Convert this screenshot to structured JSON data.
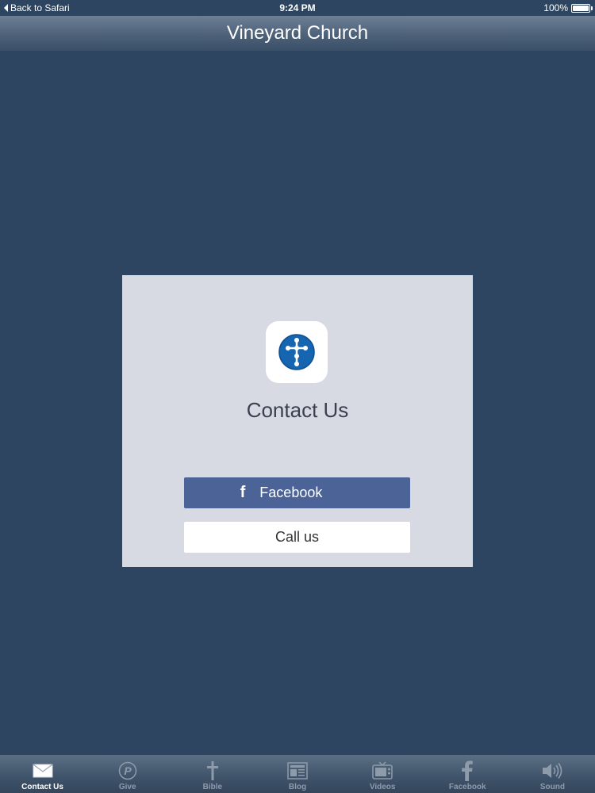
{
  "status_bar": {
    "back_label": "Back to Safari",
    "time": "9:24 PM",
    "battery": "100%",
    "battery_level": 1.0
  },
  "nav": {
    "title": "Vineyard Church"
  },
  "card": {
    "title": "Contact Us",
    "facebook_glyph": "f",
    "facebook_label": "Facebook",
    "call_label": "Call us"
  },
  "tab_bar": {
    "items": [
      {
        "label": "Contact Us",
        "icon": "envelope-icon",
        "active": true
      },
      {
        "label": "Give",
        "icon": "paypal-icon",
        "active": false
      },
      {
        "label": "Bible",
        "icon": "cross-icon",
        "active": false
      },
      {
        "label": "Blog",
        "icon": "newspaper-icon",
        "active": false
      },
      {
        "label": "Videos",
        "icon": "tv-icon",
        "active": false
      },
      {
        "label": "Facebook",
        "icon": "facebook-icon",
        "active": false
      },
      {
        "label": "Sound",
        "icon": "speaker-icon",
        "active": false
      }
    ]
  },
  "colors": {
    "background": "#2d4560",
    "card": "#d7d9e3",
    "facebook_button": "#4b6396",
    "icon_blue": "#1565b0"
  }
}
